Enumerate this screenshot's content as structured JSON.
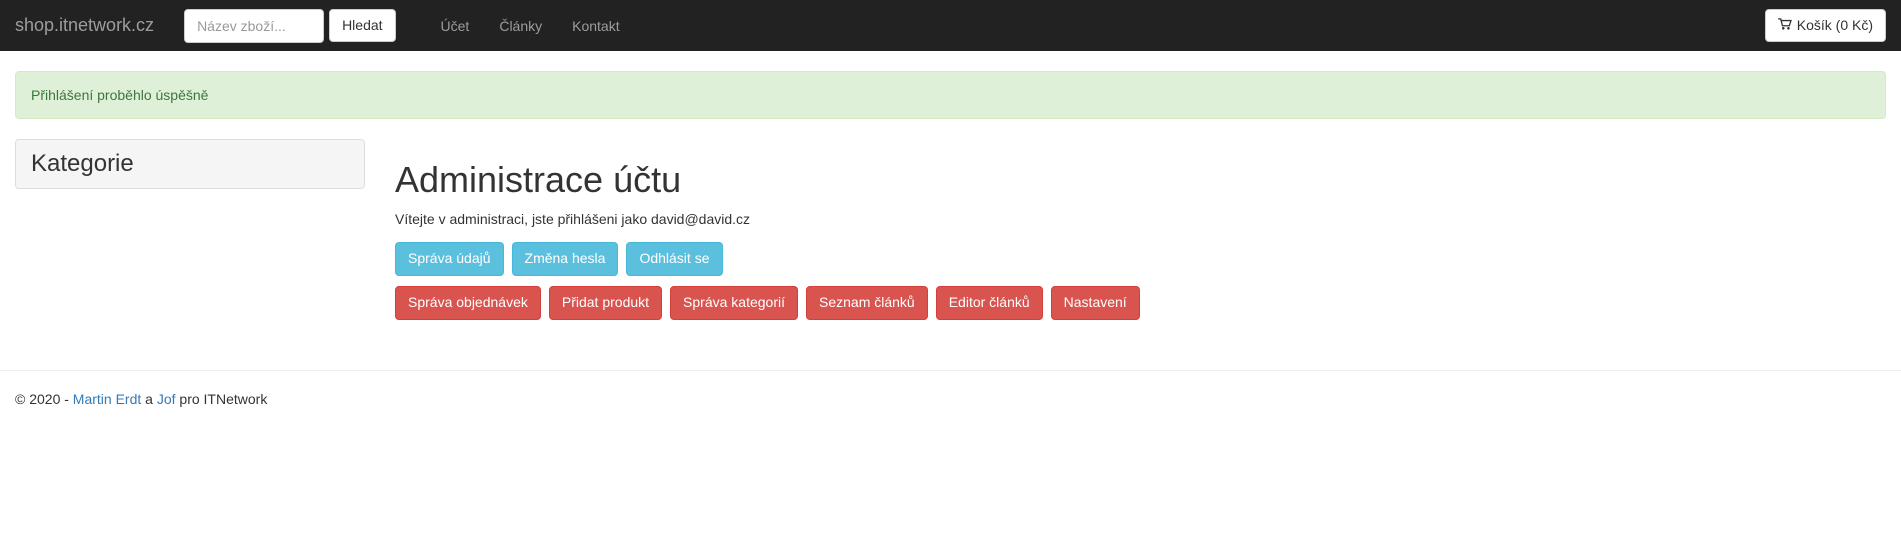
{
  "navbar": {
    "brand": "shop.itnetwork.cz",
    "search_placeholder": "Název zboží...",
    "search_button": "Hledat",
    "links": [
      {
        "label": "Účet"
      },
      {
        "label": "Články"
      },
      {
        "label": "Kontakt"
      }
    ],
    "cart_label": "Košík (0 Kč)"
  },
  "alert": {
    "message": "Přihlášení proběhlo úspěšně"
  },
  "sidebar": {
    "title": "Kategorie"
  },
  "main": {
    "heading": "Administrace účtu",
    "welcome": "Vítejte v administraci, jste přihlášeni jako david@david.cz",
    "user_buttons": [
      {
        "label": "Správa údajů"
      },
      {
        "label": "Změna hesla"
      },
      {
        "label": "Odhlásit se"
      }
    ],
    "admin_buttons": [
      {
        "label": "Správa objednávek"
      },
      {
        "label": "Přidat produkt"
      },
      {
        "label": "Správa kategorií"
      },
      {
        "label": "Seznam článků"
      },
      {
        "label": "Editor článků"
      },
      {
        "label": "Nastavení"
      }
    ]
  },
  "footer": {
    "copyright_prefix": "© 2020 - ",
    "author1": "Martin Erdt",
    "separator": " a ",
    "author2": "Jof",
    "suffix": " pro ITNetwork"
  }
}
